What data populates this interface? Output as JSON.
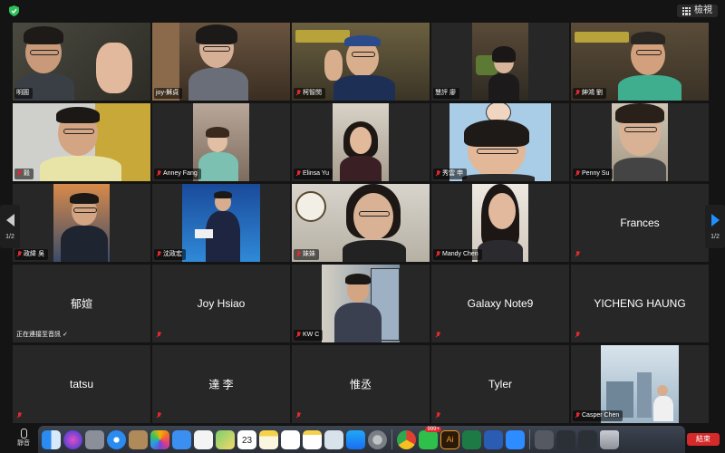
{
  "toolbar": {
    "view_label": "檢視"
  },
  "navigation": {
    "left_page": "1/2",
    "right_page": "1/2"
  },
  "participants": [
    {
      "name": "明圓",
      "video": true,
      "muted": false,
      "active": true
    },
    {
      "name": "joy-穌貞",
      "video": true,
      "muted": false
    },
    {
      "name": "柯智閔",
      "video": true,
      "muted": true
    },
    {
      "name": "慧評 廖",
      "video": true,
      "muted": false
    },
    {
      "name": "紳鴻 劉",
      "video": true,
      "muted": true
    },
    {
      "name": "穀",
      "video": true,
      "muted": true
    },
    {
      "name": "Anney Fang",
      "video": true,
      "muted": true
    },
    {
      "name": "Elinsa Yu",
      "video": true,
      "muted": true
    },
    {
      "name": "秀雲 申",
      "video": true,
      "muted": true
    },
    {
      "name": "Penny Su",
      "video": true,
      "muted": true
    },
    {
      "name": "政緯 吳",
      "video": true,
      "muted": true
    },
    {
      "name": "沈政宏",
      "video": true,
      "muted": true
    },
    {
      "name": "妹妹",
      "video": true,
      "muted": true
    },
    {
      "name": "Mandy Chen",
      "video": true,
      "muted": true
    },
    {
      "name": "Frances",
      "video": false,
      "muted": true
    },
    {
      "name": "郁媗",
      "video": false,
      "muted": false,
      "status": "正在連接至音訊 ✓"
    },
    {
      "name": "Joy Hsiao",
      "video": false,
      "muted": true
    },
    {
      "name": "KW C",
      "video": true,
      "muted": true
    },
    {
      "name": "Galaxy Note9",
      "video": false,
      "muted": true
    },
    {
      "name": "YICHENG HAUNG",
      "video": false,
      "muted": true
    },
    {
      "name": "tatsu",
      "video": false,
      "muted": true
    },
    {
      "name": "達 李",
      "video": false,
      "muted": true
    },
    {
      "name": "惟丞",
      "video": false,
      "muted": true
    },
    {
      "name": "Tyler",
      "video": false,
      "muted": true
    },
    {
      "name": "Casper Chen",
      "video": true,
      "muted": true
    }
  ],
  "bottom": {
    "mute_label": "靜音",
    "end_label": "結束",
    "calendar_day": "23",
    "badge_count": "999+"
  },
  "dock_icons": [
    "finder-icon",
    "siri-icon",
    "launchpad-icon",
    "safari-icon",
    "contacts-icon",
    "photos-icon",
    "mail-icon",
    "reminders-icon",
    "maps-icon",
    "calendar-icon",
    "notes-icon",
    "numbers-icon",
    "notes2-icon",
    "preview-icon",
    "appstore-icon",
    "settings-icon",
    "chrome-icon",
    "line-icon",
    "illustrator-icon",
    "excel-icon",
    "word-icon",
    "zoom-icon",
    "window-icon",
    "window2-icon",
    "window3-icon",
    "trash-icon"
  ]
}
